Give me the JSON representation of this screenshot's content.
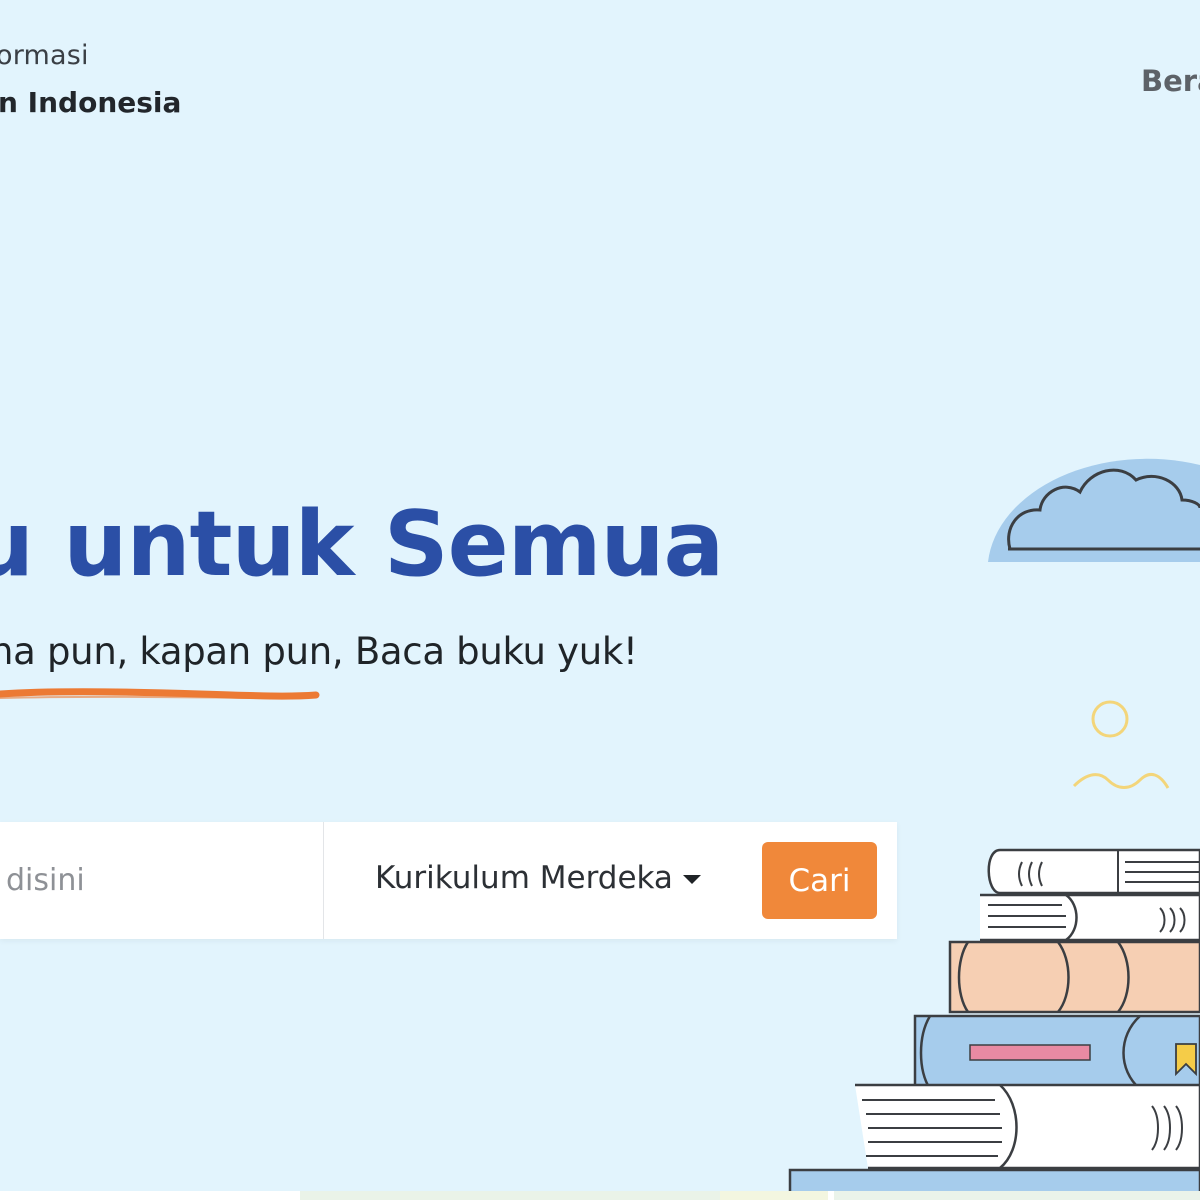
{
  "header": {
    "brand_line1": "ormasi",
    "brand_line2": "n Indonesia",
    "nav_beranda": "Bera"
  },
  "hero": {
    "title": "u untuk Semua",
    "subtitle": "na pun, kapan pun, Baca buku yuk!"
  },
  "search": {
    "placeholder": "disini",
    "curriculum_selected": "Kurikulum Merdeka",
    "submit_label": "Cari"
  },
  "colors": {
    "background": "#e2f4fd",
    "title_blue": "#2b4fa6",
    "accent_orange": "#f0883a"
  }
}
